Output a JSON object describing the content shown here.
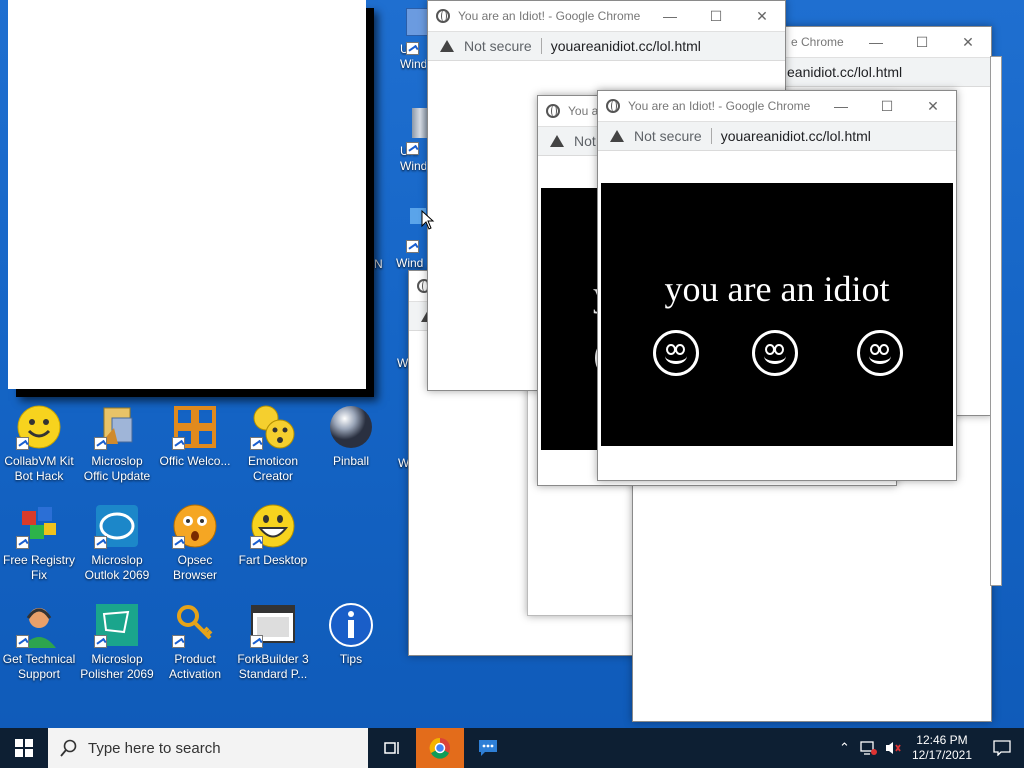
{
  "desktop": {
    "icons": [
      {
        "label": "CollabVM Kit Bot Hack",
        "name": "collabvm-kit-icon"
      },
      {
        "label": "Microslop Offic Update",
        "name": "office-update-icon"
      },
      {
        "label": "Offic Welco...",
        "name": "office-welcome-icon"
      },
      {
        "label": "Emoticon Creator",
        "name": "emoticon-creator-icon"
      },
      {
        "label": "Pinball",
        "name": "pinball-icon"
      },
      {
        "label": "Free Registry Fix",
        "name": "registry-fix-icon"
      },
      {
        "label": "Microslop Outlok 2069",
        "name": "outlok-icon"
      },
      {
        "label": "Opsec Browser",
        "name": "opsec-browser-icon"
      },
      {
        "label": "Fart Desktop",
        "name": "fart-desktop-icon"
      },
      {
        "label": "Get Technical Support",
        "name": "tech-support-icon"
      },
      {
        "label": "Microslop Polisher 2069",
        "name": "polisher-icon"
      },
      {
        "label": "Product Activation",
        "name": "product-activation-icon"
      },
      {
        "label": "ForkBuilder 3 Standard P...",
        "name": "forkbuilder-icon"
      },
      {
        "label": "Tips",
        "name": "tips-icon"
      }
    ],
    "partial_labels": {
      "a": "Uni Wind",
      "b": "Uni Wind",
      "c": "Wind",
      "d": "W",
      "e": "W",
      "f": "N"
    }
  },
  "popups": {
    "title": "You are an Idiot! - Google Chrome",
    "title_short": "You ar",
    "title_right": "e Chrome",
    "not_secure": "Not secure",
    "not_secure_short": "Not",
    "url": "youareanidiot.cc/lol.html",
    "url_right": "eanidiot.cc/lol.html",
    "message": "you are an idiot",
    "message_short": "y"
  },
  "taskbar": {
    "search_placeholder": "Type here to search",
    "time": "12:46 PM",
    "date": "12/17/2021"
  },
  "colors": {
    "desktop": "#1565c6",
    "taskbar": "#0d1f33",
    "chrome_active": "#e36c1b"
  }
}
